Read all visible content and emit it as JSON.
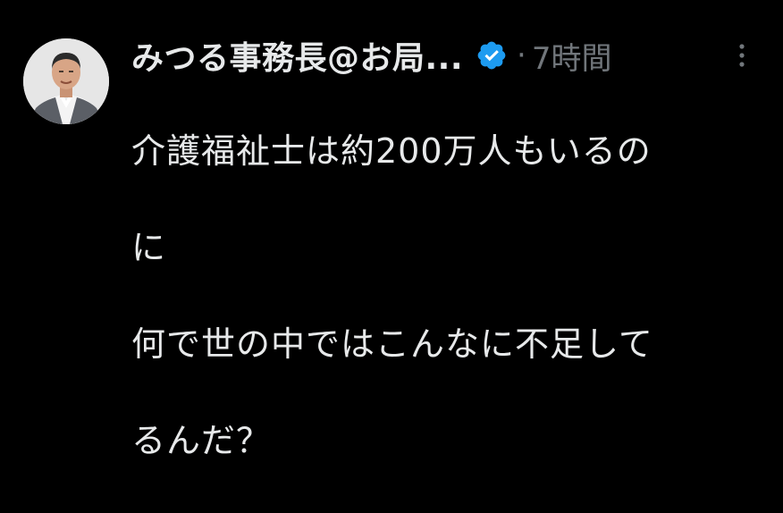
{
  "tweet": {
    "author": {
      "display_name": "みつる事務長@お局...",
      "verified": true,
      "avatar_icon": "profile-photo"
    },
    "separator": "·",
    "timestamp": "7時間",
    "more_icon": "more-vertical-icon",
    "body_lines": [
      "介護福祉士は約200万人もいるの",
      "に",
      "何で世の中ではこんなに不足して",
      "るんだ？"
    ]
  },
  "colors": {
    "background": "#000000",
    "text": "#e7e9ea",
    "muted": "#71767b",
    "verified_badge": "#1d9bf0"
  }
}
